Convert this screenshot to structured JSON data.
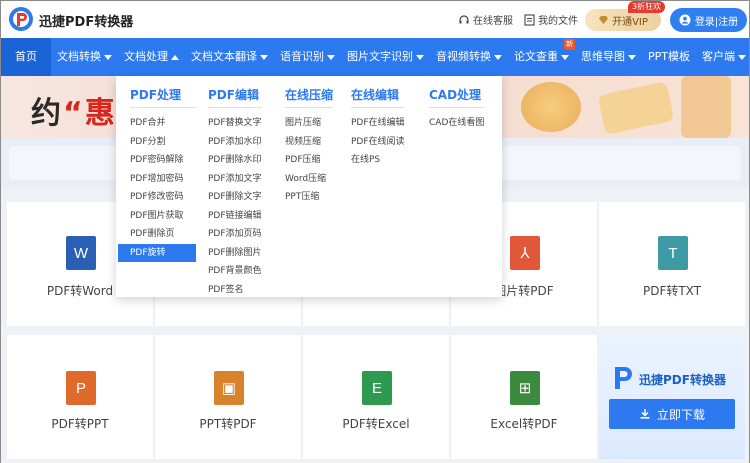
{
  "header": {
    "app_name": "迅捷PDF转换器",
    "service": "在线客服",
    "my_files": "我的文件",
    "vip_label": "开通VIP",
    "vip_badge": "3折狂欢",
    "login_label": "登录|注册"
  },
  "nav": {
    "items": [
      {
        "label": "首页",
        "caret": ""
      },
      {
        "label": "文档转换",
        "caret": "down"
      },
      {
        "label": "文档处理",
        "caret": "up"
      },
      {
        "label": "文档文本翻译",
        "caret": "down"
      },
      {
        "label": "语音识别",
        "caret": "down"
      },
      {
        "label": "图片文字识别",
        "caret": "down"
      },
      {
        "label": "音视频转换",
        "caret": "down"
      },
      {
        "label": "论文查重",
        "caret": "down"
      },
      {
        "label": "思维导图",
        "caret": "down"
      },
      {
        "label": "PPT模板",
        "caret": ""
      },
      {
        "label": "客户端",
        "caret": "down"
      }
    ],
    "new_badge": "新"
  },
  "banner": {
    "text_prefix": "约",
    "text_highlight": "“惠"
  },
  "dropdown": {
    "columns": [
      {
        "title": "PDF处理",
        "items": [
          "PDF合并",
          "PDF分割",
          "PDF密码解除",
          "PDF增加密码",
          "PDF修改密码",
          "PDF图片获取",
          "PDF删除页",
          "PDF旋转"
        ],
        "active_index": 7
      },
      {
        "title": "PDF编辑",
        "items": [
          "PDF替换文字",
          "PDF添加水印",
          "PDF删除水印",
          "PDF添加文字",
          "PDF删除文字",
          "PDF链接编辑",
          "PDF添加页码",
          "PDF删除图片",
          "PDF背景颜色",
          "PDF签名"
        ]
      },
      {
        "title": "在线压缩",
        "items": [
          "图片压缩",
          "视频压缩",
          "PDF压缩",
          "Word压缩",
          "PPT压缩"
        ]
      },
      {
        "title": "在线编辑",
        "items": [
          "PDF在线编辑",
          "PDF在线阅读",
          "在线PS"
        ]
      },
      {
        "title": "CAD处理",
        "items": [
          "CAD在线看图"
        ]
      }
    ]
  },
  "tools": {
    "row1": [
      {
        "label": "PDF转Word",
        "icon": "W",
        "icon_name": "word-file-icon",
        "color": "#2b5fb4"
      },
      {
        "label": "",
        "icon": "",
        "icon_name": "",
        "color": ""
      },
      {
        "label": "",
        "icon": "",
        "icon_name": "",
        "color": ""
      },
      {
        "label": "图片转PDF",
        "icon": "⅄",
        "icon_name": "pdf-file-icon",
        "color": "#e0573a"
      },
      {
        "label": "PDF转TXT",
        "icon": "T",
        "icon_name": "txt-file-icon",
        "color": "#3e9aa5"
      }
    ],
    "row2": [
      {
        "label": "PDF转PPT",
        "icon": "P",
        "icon_name": "ppt-file-icon",
        "color": "#e06a2c"
      },
      {
        "label": "PPT转PDF",
        "icon": "▣",
        "icon_name": "ppt-to-pdf-icon",
        "color": "#d9822b"
      },
      {
        "label": "PDF转Excel",
        "icon": "E",
        "icon_name": "excel-file-icon",
        "color": "#2e9a4f"
      },
      {
        "label": "Excel转PDF",
        "icon": "⊞",
        "icon_name": "excel-to-pdf-icon",
        "color": "#3b8a3e"
      }
    ]
  },
  "promo": {
    "name": "迅捷PDF转换器",
    "download_label": "立即下载"
  },
  "colors": {
    "primary": "#2d7af0",
    "nav_home": "#1a64d6",
    "badge_red": "#e33b2f"
  }
}
